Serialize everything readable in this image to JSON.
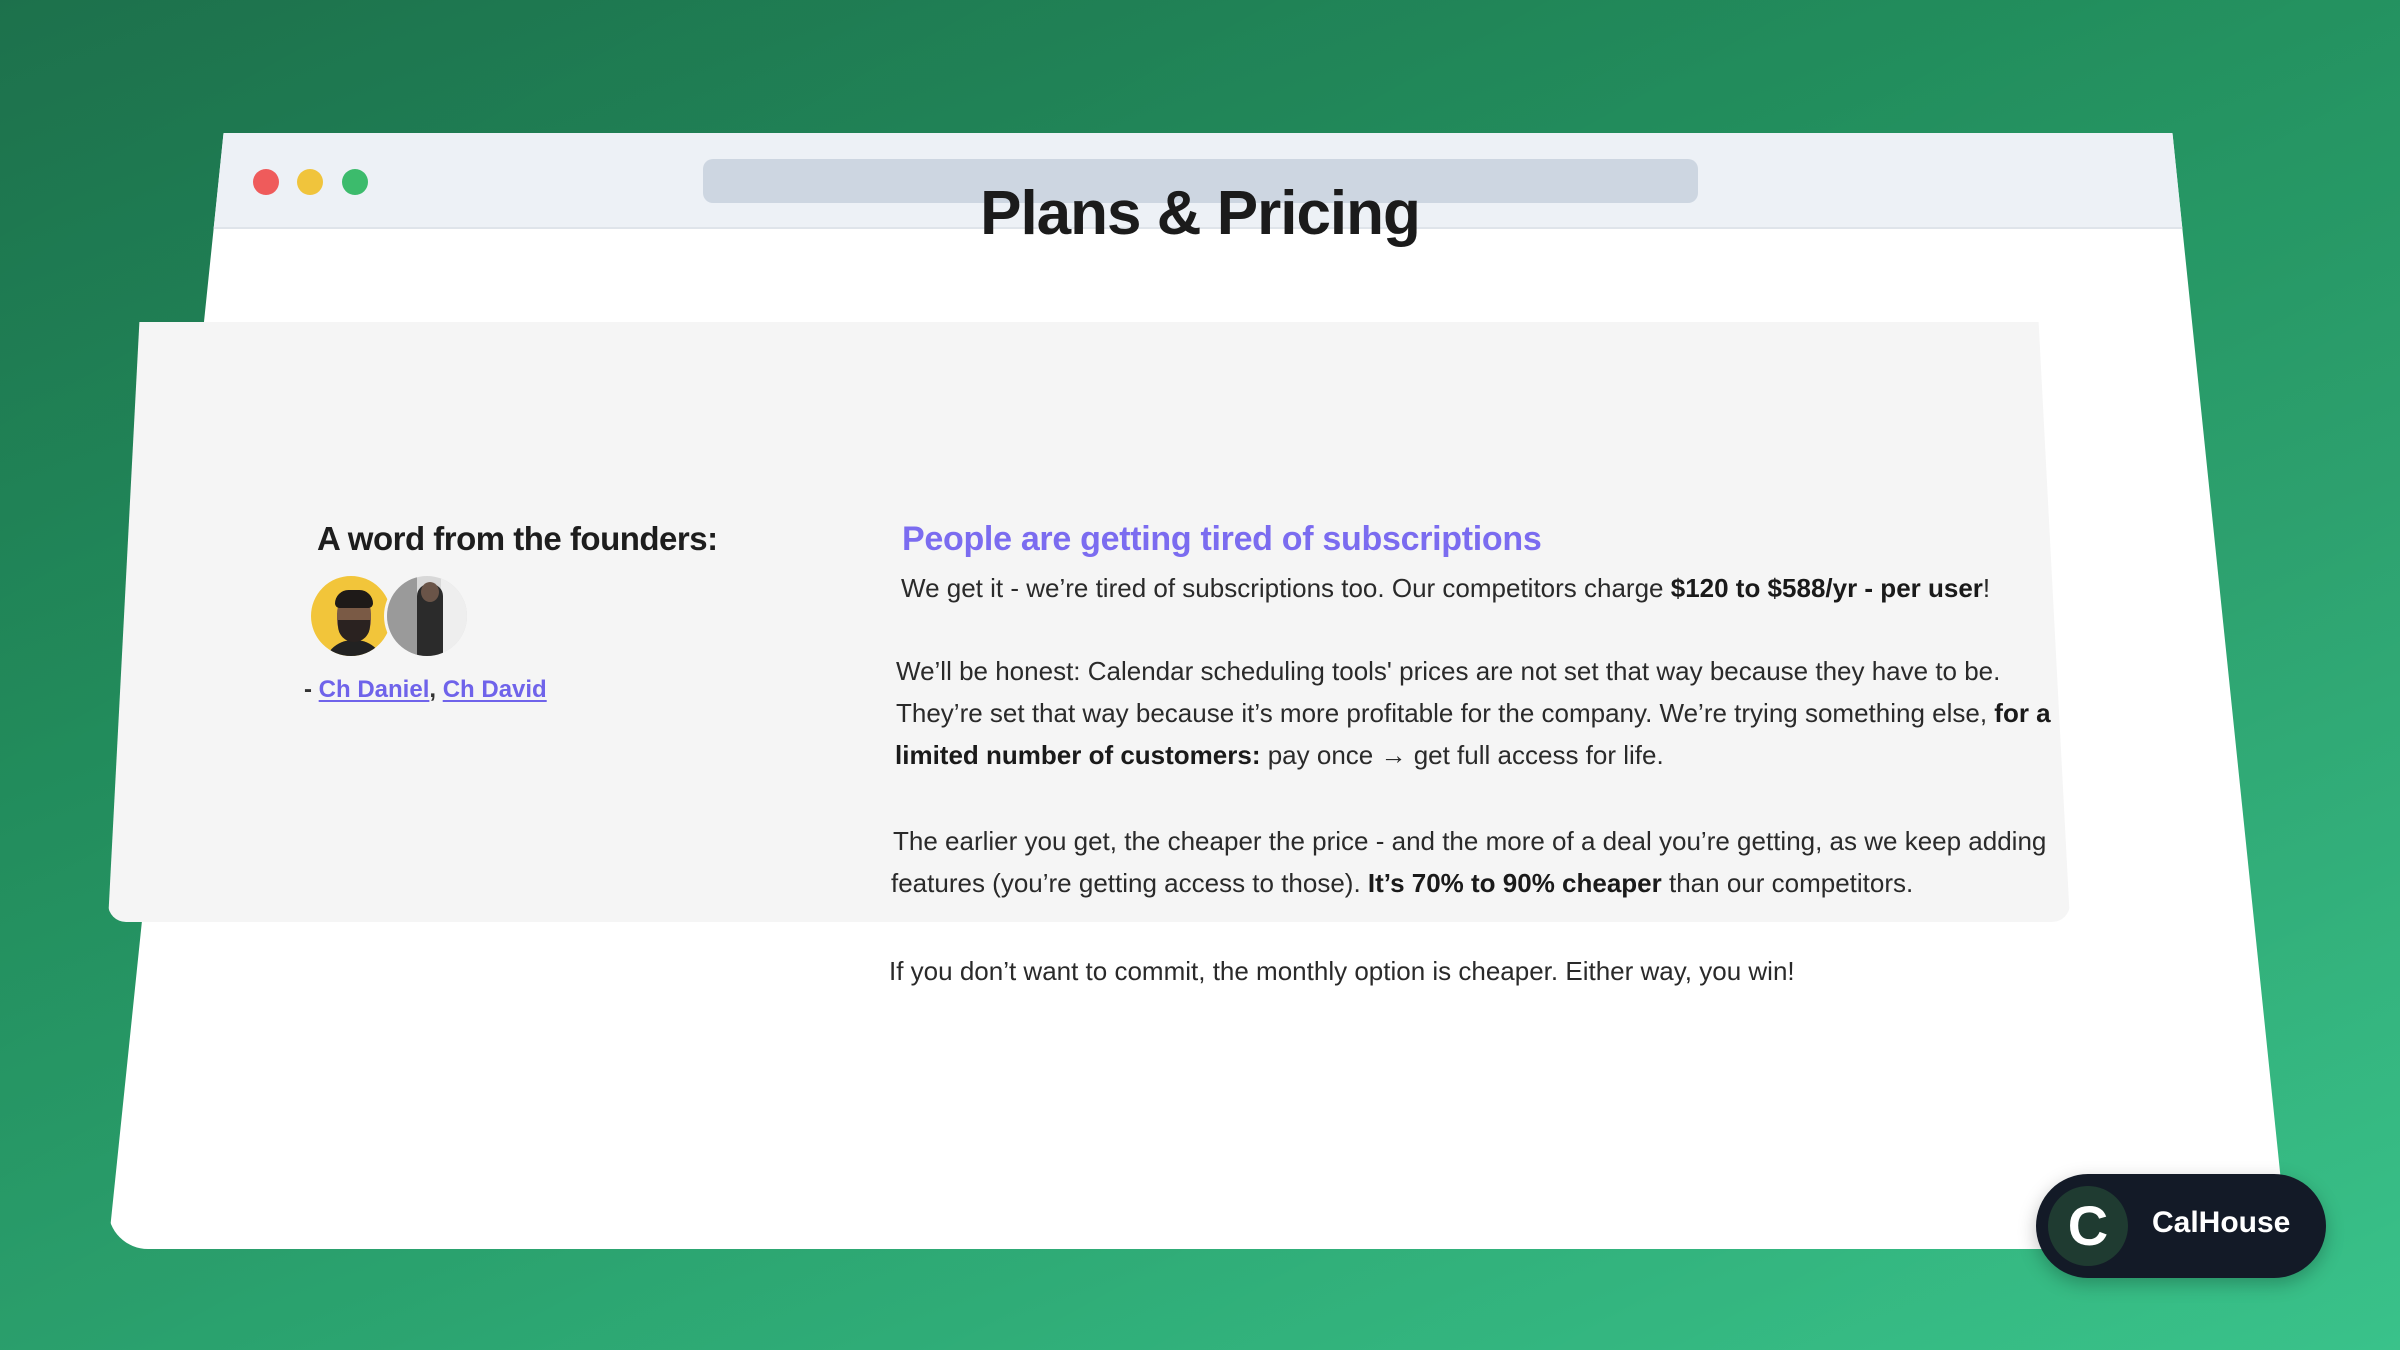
{
  "page": {
    "title": "Plans & Pricing"
  },
  "founders": {
    "heading": "A word from the founders:",
    "prefix": "-",
    "separator": ",",
    "names": [
      "Ch Daniel",
      "Ch David"
    ]
  },
  "content": {
    "heading": "People are getting tired of subscriptions",
    "p1": {
      "text": "We get it - we’re tired of subscriptions too. Our competitors charge ",
      "bold": "$120 to $588/yr - per user",
      "end": "!"
    },
    "p2": {
      "line1": "We’ll be honest: Calendar scheduling tools' prices are not set that way because they have to be.",
      "line2_text": "They’re set that way because it’s more profitable for the company. We’re trying something else, ",
      "line2_bold": "for a",
      "line3_bold": "limited number of customers:",
      "line3_text": " pay once → get full access for life."
    },
    "p3": {
      "line1": "The earlier you get, the cheaper the price - and the more of a deal you’re getting, as we keep adding",
      "line2_text": "features (you’re getting access to those). ",
      "line2_bold": "It’s 70% to 90% cheaper",
      "line2_end": " than our competitors."
    },
    "p4": "If you don’t want to commit, the monthly option is cheaper. Either way, you win!"
  },
  "badge": {
    "logo_letter": "C",
    "label": "CalHouse"
  },
  "colors": {
    "accent": "#7b6cf0",
    "link": "#6f63ea",
    "background_start": "#1f7a52",
    "background_end": "#2fbf84",
    "badge_bg": "#131a27"
  }
}
